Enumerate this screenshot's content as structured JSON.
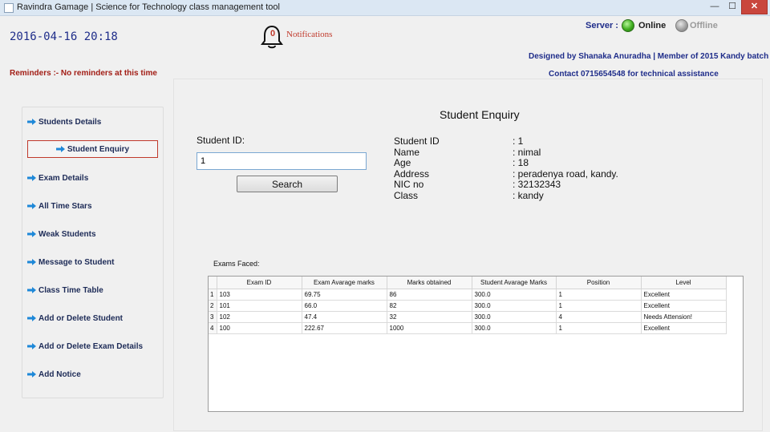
{
  "window": {
    "title": "Ravindra Gamage | Science for Technology class management tool",
    "min_label": "—",
    "max_label": "☐",
    "close_label": "✕"
  },
  "header": {
    "datetime": "2016-04-16 20:18",
    "notifications": {
      "count": "0",
      "label": "Notifications",
      "icon": "bell-icon"
    },
    "server": {
      "label": "Server :",
      "online": "Online",
      "offline": "Offline",
      "online_color": "#3fae1f",
      "offline_color": "#9c9c9c"
    },
    "designed_by": "Designed by Shanaka Anuradha | Member of 2015 Kandy  batch",
    "contact": "Contact 0715654548 for technical assistance",
    "reminders": "Reminders :- No reminders at this time"
  },
  "sidebar": {
    "items": [
      {
        "label": "Students Details"
      },
      {
        "label": "Student Enquiry",
        "active": true
      },
      {
        "label": "Exam Details"
      },
      {
        "label": "All Time Stars"
      },
      {
        "label": "Weak Students"
      },
      {
        "label": "Message to Student"
      },
      {
        "label": "Class Time Table"
      },
      {
        "label": "Add or Delete Student"
      },
      {
        "label": "Add or Delete Exam Details"
      },
      {
        "label": "Add Notice"
      }
    ],
    "icon": "arrow-right-icon",
    "accent": "#c0392b"
  },
  "enquiry": {
    "title": "Student Enquiry",
    "student_id_label": "Student ID:",
    "student_id_value": "1",
    "search_label": "Search",
    "info": [
      {
        "key": "Student ID",
        "value": ": 1"
      },
      {
        "key": "Name",
        "value": ": nimal"
      },
      {
        "key": "Age",
        "value": ": 18"
      },
      {
        "key": "Address",
        "value": ": peradenya road, kandy."
      },
      {
        "key": "NIC no",
        "value": ": 32132343"
      },
      {
        "key": "Class",
        "value": ": kandy"
      }
    ],
    "exams_label": "Exams Faced:"
  },
  "exams_table": {
    "columns": [
      "Exam ID",
      "Exam Avarage marks",
      "Marks obtained",
      "Student Avarage Marks",
      "Position",
      "Level"
    ],
    "rows": [
      {
        "n": "1",
        "cells": [
          "103",
          "69.75",
          "86",
          "300.0",
          "1",
          "Excellent"
        ]
      },
      {
        "n": "2",
        "cells": [
          "101",
          "66.0",
          "82",
          "300.0",
          "1",
          "Excellent"
        ]
      },
      {
        "n": "3",
        "cells": [
          "102",
          "47.4",
          "32",
          "300.0",
          "4",
          "Needs Attension!"
        ]
      },
      {
        "n": "4",
        "cells": [
          "100",
          "222.67",
          "1000",
          "300.0",
          "1",
          "Excellent"
        ]
      }
    ]
  }
}
